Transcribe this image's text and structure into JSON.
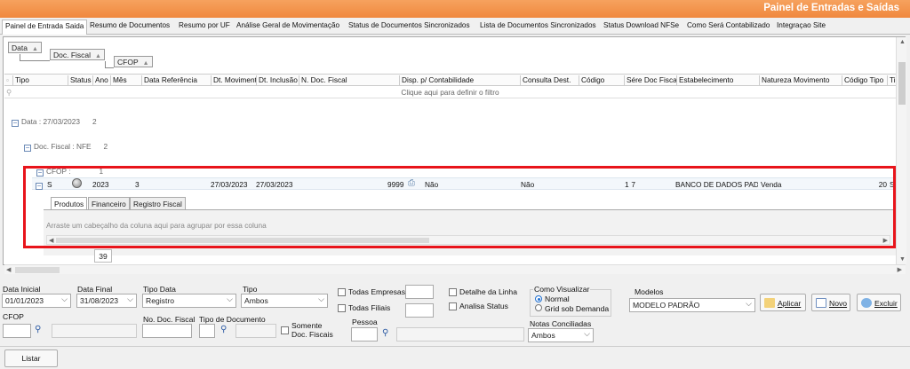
{
  "window_title": "Painel de Entradas e Saídas",
  "tabs": [
    {
      "label": "Painel de Entrada Saida",
      "active": true
    },
    {
      "label": "Resumo de Documentos"
    },
    {
      "label": "Resumo por UF"
    },
    {
      "label": "Análise Geral de Movimentação"
    },
    {
      "label": "Status de Documentos Sincronizados"
    },
    {
      "label": "Lista de Documentos Sincronizados"
    },
    {
      "label": "Status Download NFSe"
    },
    {
      "label": "Como Será Contabilizado"
    },
    {
      "label": "Integraçao Site"
    }
  ],
  "group_by": [
    "Data",
    "Doc. Fiscal",
    "CFOP"
  ],
  "columns": [
    "Tipo",
    "Status",
    "Ano",
    "Mês",
    "Data Referência",
    "Dt. Movimento",
    "Dt. Inclusão",
    "N. Doc. Fiscal",
    "Disp. p/ Contabilidade",
    "Consulta Dest.",
    "Código",
    "Sére Doc Fiscal",
    "Estabelecimento",
    "Natureza Movimento",
    "Código Tipo",
    "Tipo"
  ],
  "filter_hint": "Clique aqui para definir o filtro",
  "groups": {
    "data": {
      "label": "Data : 27/03/2023",
      "count": "2"
    },
    "doc": {
      "label": "Doc. Fiscal : NFE",
      "count": "2"
    },
    "cfop": {
      "label": "CFOP :",
      "count": "1"
    }
  },
  "row": {
    "tipo": "S",
    "ano": "2023",
    "mes": "3",
    "dt_mov": "27/03/2023",
    "dt_inc": "27/03/2023",
    "n_doc": "9999",
    "disp": "Não",
    "consulta": "Não",
    "codigo": "7",
    "serie": "1",
    "estab": "BANCO DE DADOS PADR",
    "natureza": "Venda",
    "cod_tipo": "20",
    "tipo2": "S"
  },
  "subtabs": [
    "Produtos",
    "Financeiro",
    "Registro Fiscal"
  ],
  "drag_hint": "Arraste um cabeçalho da coluna aqui para agrupar por essa coluna",
  "record_count": "39",
  "form": {
    "data_inicial_label": "Data Inicial",
    "data_inicial": "01/01/2023",
    "data_final_label": "Data Final",
    "data_final": "31/08/2023",
    "tipo_data_label": "Tipo Data",
    "tipo_data": "Registro",
    "tipo_label": "Tipo",
    "tipo": "Ambos",
    "todas_empresas": "Todas Empresas",
    "todas_filiais": "Todas Filiais",
    "detalhe_linha": "Detalhe da Linha",
    "analisa_status": "Analisa Status",
    "como_visualizar": "Como Visualizar",
    "normal": "Normal",
    "grid_demanda": "Grid sob Demanda",
    "modelos_label": "Modelos",
    "modelos": "MODELO PADRÃO",
    "aplicar": "Aplicar",
    "novo": "Novo",
    "excluir": "Excluir",
    "cfop_label": "CFOP",
    "no_doc_label": "No. Doc. Fiscal",
    "tipo_doc_label": "Tipo de Documento",
    "somente_doc": "Somente Doc. Fiscais",
    "pessoa_label": "Pessoa",
    "notas_label": "Notas Conciliadas",
    "notas": "Ambos"
  },
  "listar": "Listar",
  "colors": {
    "title_bar": "#f0883e",
    "highlight": "#e8141b",
    "radio": "#1f6fd1"
  }
}
